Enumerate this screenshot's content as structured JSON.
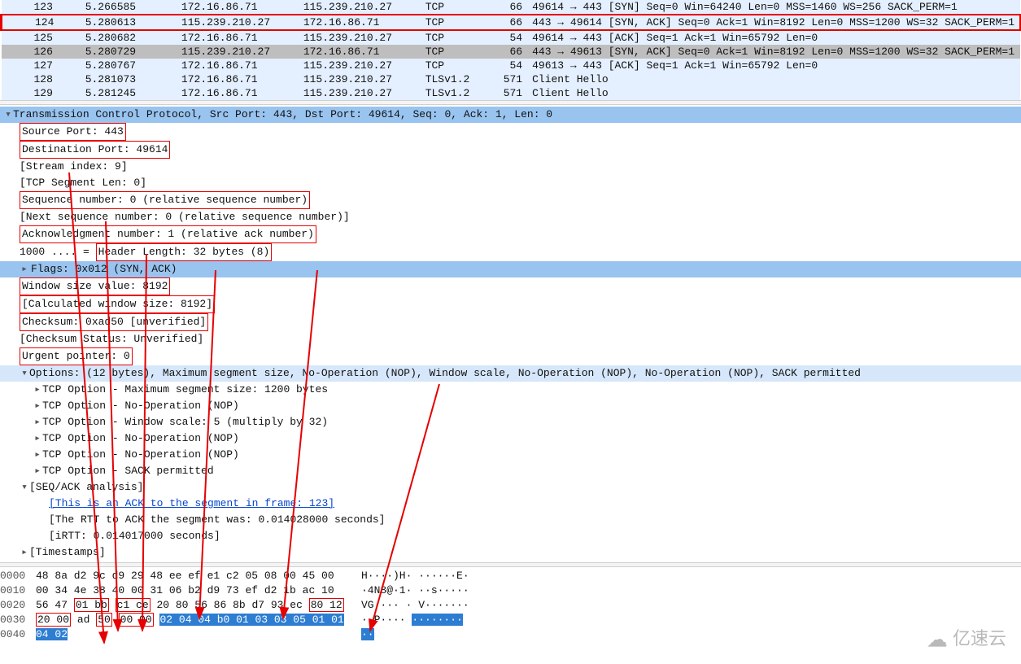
{
  "packets": [
    {
      "no": "123",
      "time": "5.266585",
      "src": "172.16.86.71",
      "dst": "115.239.210.27",
      "proto": "TCP",
      "len": "66",
      "info": "49614 → 443 [SYN] Seq=0 Win=64240 Len=0 MSS=1460 WS=256 SACK_PERM=1",
      "bg": "row-bg0",
      "sel": false
    },
    {
      "no": "124",
      "time": "5.280613",
      "src": "115.239.210.27",
      "dst": "172.16.86.71",
      "proto": "TCP",
      "len": "66",
      "info": "443 → 49614 [SYN, ACK] Seq=0 Ack=1 Win=8192 Len=0 MSS=1200 WS=32 SACK_PERM=1",
      "bg": "row-bg1",
      "sel": true
    },
    {
      "no": "125",
      "time": "5.280682",
      "src": "172.16.86.71",
      "dst": "115.239.210.27",
      "proto": "TCP",
      "len": "54",
      "info": "49614 → 443 [ACK] Seq=1 Ack=1 Win=65792 Len=0",
      "bg": "row-bg2",
      "sel": false
    },
    {
      "no": "126",
      "time": "5.280729",
      "src": "115.239.210.27",
      "dst": "172.16.86.71",
      "proto": "TCP",
      "len": "66",
      "info": "443 → 49613 [SYN, ACK] Seq=0 Ack=1 Win=8192 Len=0 MSS=1200 WS=32 SACK_PERM=1",
      "bg": "row-bg3",
      "sel": false
    },
    {
      "no": "127",
      "time": "5.280767",
      "src": "172.16.86.71",
      "dst": "115.239.210.27",
      "proto": "TCP",
      "len": "54",
      "info": "49613 → 443 [ACK] Seq=1 Ack=1 Win=65792 Len=0",
      "bg": "row-bg4",
      "sel": false
    },
    {
      "no": "128",
      "time": "5.281073",
      "src": "172.16.86.71",
      "dst": "115.239.210.27",
      "proto": "TLSv1.2",
      "len": "571",
      "info": "Client Hello",
      "bg": "row-bg5",
      "sel": false
    },
    {
      "no": "129",
      "time": "5.281245",
      "src": "172.16.86.71",
      "dst": "115.239.210.27",
      "proto": "TLSv1.2",
      "len": "571",
      "info": "Client Hello",
      "bg": "row-bg6",
      "sel": false
    }
  ],
  "details": {
    "header": "Transmission Control Protocol, Src Port: 443, Dst Port: 49614, Seq: 0, Ack: 1, Len: 0",
    "src_port": "Source Port: 443",
    "dst_port": "Destination Port: 49614",
    "stream": "[Stream index: 9]",
    "seglen": "[TCP Segment Len: 0]",
    "seq": "Sequence number: 0    (relative sequence number)",
    "nextseq": "[Next sequence number: 0    (relative sequence number)]",
    "ack": "Acknowledgment number: 1    (relative ack number)",
    "hlen_pre": "1000 .... =",
    "hlen": "Header Length: 32 bytes (8)",
    "flags": "Flags: 0x012 (SYN, ACK)",
    "win": "Window size value: 8192",
    "cwin": "[Calculated window size: 8192]",
    "cksum": "Checksum: 0xad50 [unverified]",
    "ckstat": "[Checksum Status: Unverified]",
    "urg": "Urgent pointer: 0",
    "opts": "Options: (12 bytes), Maximum segment size, No-Operation (NOP), Window scale, No-Operation (NOP), No-Operation (NOP), SACK permitted",
    "opt_mss": "TCP Option - Maximum segment size: 1200 bytes",
    "opt_nop1": "TCP Option - No-Operation (NOP)",
    "opt_ws": "TCP Option - Window scale: 5 (multiply by 32)",
    "opt_nop2": "TCP Option - No-Operation (NOP)",
    "opt_nop3": "TCP Option - No-Operation (NOP)",
    "opt_sack": "TCP Option - SACK permitted",
    "seqack": "[SEQ/ACK analysis]",
    "acklink": "[This is an ACK to the segment in frame: 123]",
    "rtt": "[The RTT to ACK the segment was: 0.014028000 seconds]",
    "irtt": "[iRTT: 0.014017000 seconds]",
    "ts": "[Timestamps]"
  },
  "hex": {
    "rows": [
      {
        "off": "0000",
        "b": "48 8a d2 9c d9 29 48 ee  ef e1 c2 05 08 00 45 00",
        "a": "H····)H· ······E·"
      },
      {
        "off": "0010",
        "b": "00 34 4e 38 40 00 31 06  b2 d9 73 ef d2 1b ac 10",
        "a": "·4N8@·1· ··s·····"
      },
      {
        "off": "0020",
        "b": "56 47 01 bb c1 ce 20 80  56 86 8b d7 93 ec 80 12",
        "a": "VG···· · V·······"
      },
      {
        "off": "0030",
        "b": "20 00 ad 50 00 00 02 04  04 b0 01 03 03 05 01 01",
        "a": " ··P···· ········"
      },
      {
        "off": "0040",
        "b": "04 02",
        "a": "··"
      }
    ]
  },
  "watermark": "亿速云"
}
